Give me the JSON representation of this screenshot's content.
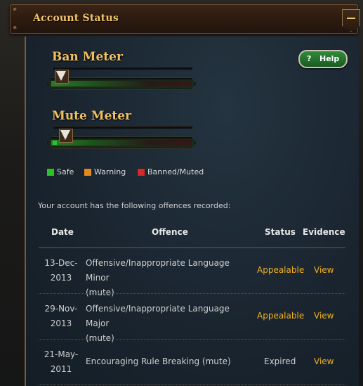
{
  "window": {
    "title": "Account Status"
  },
  "help": {
    "label": "Help",
    "icon": "question-icon"
  },
  "ban_meter": {
    "title": "Ban Meter",
    "level_fraction": 0.0
  },
  "mute_meter": {
    "title": "Mute Meter",
    "level_fraction": 0.04
  },
  "legend": [
    {
      "label": "Safe",
      "color": "#29c229"
    },
    {
      "label": "Warning",
      "color": "#e08a20"
    },
    {
      "label": "Banned/Muted",
      "color": "#d42a2a"
    }
  ],
  "intro_text": "Your account has the following offences recorded:",
  "table": {
    "headers": {
      "date": "Date",
      "offence": "Offence",
      "status": "Status",
      "evidence": "Evidence"
    },
    "rows": [
      {
        "date_line1": "13-Dec-",
        "date_line2": "2013",
        "offence_line1": "Offensive/Inappropriate Language Minor",
        "offence_line2": "(mute)",
        "status": "Appealable",
        "evidence": "View"
      },
      {
        "date_line1": "29-Nov-",
        "date_line2": "2013",
        "offence_line1": "Offensive/Inappropriate Language Major",
        "offence_line2": "(mute)",
        "status": "Appealable",
        "evidence": "View"
      },
      {
        "date_line1": "21-May-",
        "date_line2": "2011",
        "offence_line1": "Encouraging Rule Breaking (mute)",
        "offence_line2": "",
        "status": "Expired",
        "evidence": "View"
      }
    ]
  },
  "colors": {
    "accent": "#f0b020",
    "title": "#f3c56a",
    "help_button": "#2e8c3a"
  }
}
